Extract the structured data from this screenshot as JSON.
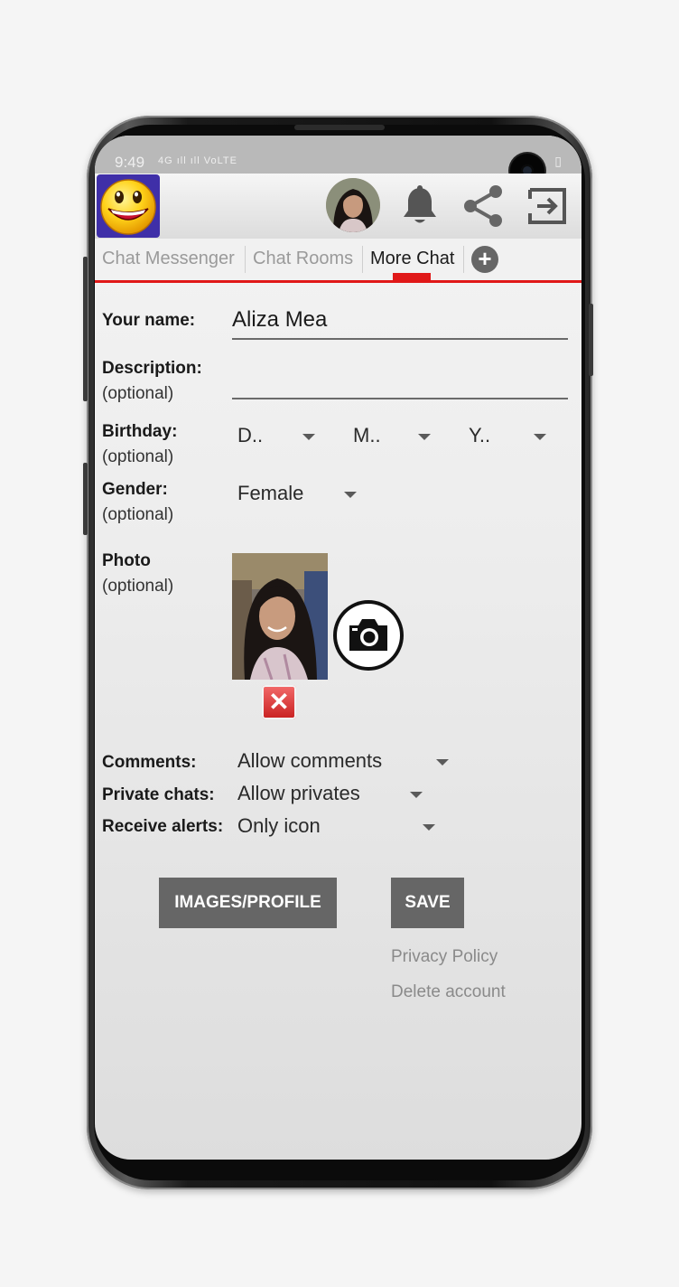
{
  "status_bar": {
    "time": "9:49",
    "signal": "4G ıll ıll VoLTE",
    "battery": "▯"
  },
  "toolbar": {
    "logo_icon": "smiley-face-icon",
    "avatar_icon": "profile-avatar",
    "icons": [
      "bell-icon",
      "share-icon",
      "logout-icon"
    ]
  },
  "tabs": [
    {
      "label": "Chat Messenger",
      "active": false
    },
    {
      "label": "Chat Rooms",
      "active": false
    },
    {
      "label": "More Chat",
      "active": true
    }
  ],
  "tabs_add_icon": "plus-circle-icon",
  "form": {
    "name_label": "Your name:",
    "name_value": "Aliza Mea",
    "description_label": "Description:",
    "description_optional": "(optional)",
    "description_value": "",
    "birthday_label": "Birthday:",
    "birthday_optional": "(optional)",
    "birthday_day": "D..",
    "birthday_month": "M..",
    "birthday_year": "Y..",
    "gender_label": "Gender:",
    "gender_optional": "(optional)",
    "gender_value": "Female",
    "photo_label": "Photo",
    "photo_optional": "(optional)",
    "comments_label": "Comments:",
    "comments_value": "Allow comments",
    "private_label": "Private chats:",
    "private_value": "Allow privates",
    "alerts_label": "Receive alerts:",
    "alerts_value": "Only icon"
  },
  "buttons": {
    "images_profile": "IMAGES/PROFILE",
    "save": "SAVE"
  },
  "links": {
    "privacy": "Privacy Policy",
    "delete": "Delete account"
  },
  "colors": {
    "accent": "#e01818",
    "button_bg": "#666666",
    "logo_bg": "#3f2fa8"
  }
}
